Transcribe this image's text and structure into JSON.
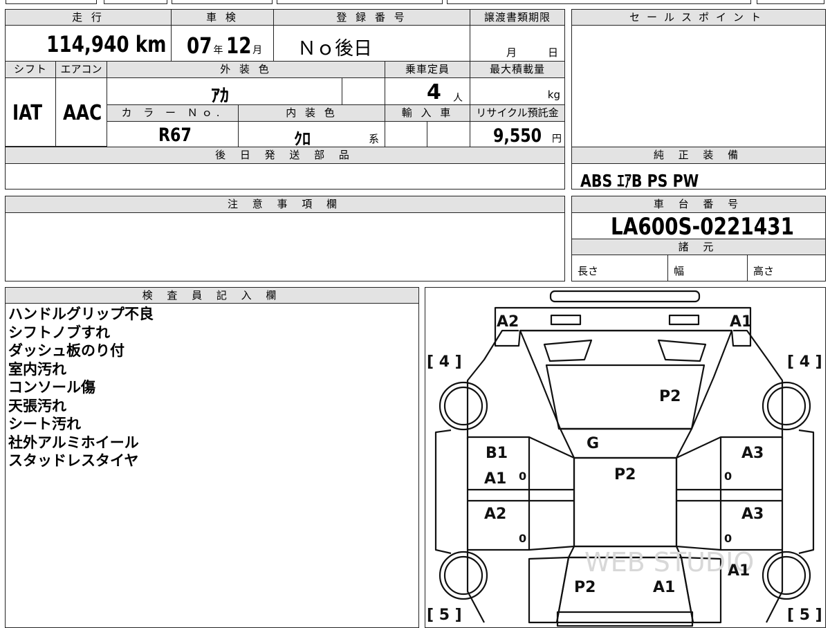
{
  "top_strip": {
    "text": ""
  },
  "main": {
    "mileage": {
      "label": "走 行",
      "value": "114,940",
      "unit": "km"
    },
    "shaken": {
      "label": "車 検",
      "year": "07",
      "year_unit": "年",
      "month": "12",
      "month_unit": "月"
    },
    "registration": {
      "label": "登 録 番 号",
      "value": "Ｎｏ後日"
    },
    "transfer_deadline": {
      "label": "譲渡書類期限",
      "month_unit": "月",
      "day_unit": "日"
    },
    "shift": {
      "label": "シフト",
      "value": "IAT"
    },
    "aircon": {
      "label": "エアコン",
      "value": "AAC"
    },
    "exterior_color": {
      "label": "外 装 色",
      "value": "ｱｶ"
    },
    "capacity": {
      "label": "乗車定員",
      "value": "4",
      "unit": "人"
    },
    "max_load": {
      "label": "最大積載量",
      "unit": "kg"
    },
    "color_no": {
      "label": "カ ラ ー Ｎｏ.",
      "value": "R67"
    },
    "interior_color": {
      "label": "内 装 色",
      "value": "ｸﾛ",
      "suffix": "系"
    },
    "import": {
      "label": "輸 入 車"
    },
    "recycle": {
      "label": "リサイクル預託金",
      "value": "9,550",
      "unit": "円"
    },
    "later_parts": {
      "label": "後 日 発 送 部 品",
      "value": ""
    }
  },
  "sales_point": {
    "label": "セールスポイント",
    "value": ""
  },
  "genuine_equipment": {
    "label": "純 正 装 備",
    "value": "ABS ｴｱB PS PW"
  },
  "caution": {
    "label": "注 意 事 項 欄",
    "value": ""
  },
  "chassis": {
    "label": "車 台 番 号",
    "value": "LA600S-0221431"
  },
  "specs": {
    "label": "諸 元",
    "length": "長さ",
    "width": "幅",
    "height": "高さ"
  },
  "inspector": {
    "label": "検 査 員 記 入 欄",
    "notes": [
      "ハンドルグリップ不良",
      "シフトノブすれ",
      "ダッシュ板のり付",
      "室内汚れ",
      "コンソール傷",
      "天張汚れ",
      "シート汚れ",
      "社外アルミホイール",
      "スタッドレスタイヤ"
    ]
  },
  "diagram": {
    "marks": {
      "front_left": "A2",
      "front_right": "A1",
      "hood": "P2",
      "windshield": "G",
      "roof": "P2",
      "left_front_door_1": "B1",
      "left_front_door_2": "A1",
      "left_rear_door": "A2",
      "right_front_door": "A3",
      "right_rear_door": "A3",
      "right_rear_quarter": "A1",
      "rear_left": "P2",
      "rear_right": "A1",
      "door_zero": "0"
    },
    "tires": {
      "front_left": "[ 4 ]",
      "front_right": "[ 4 ]",
      "rear_left": "[ 5 ]",
      "rear_right": "[ 5 ]"
    },
    "watermark": "WEB STUDIO"
  }
}
